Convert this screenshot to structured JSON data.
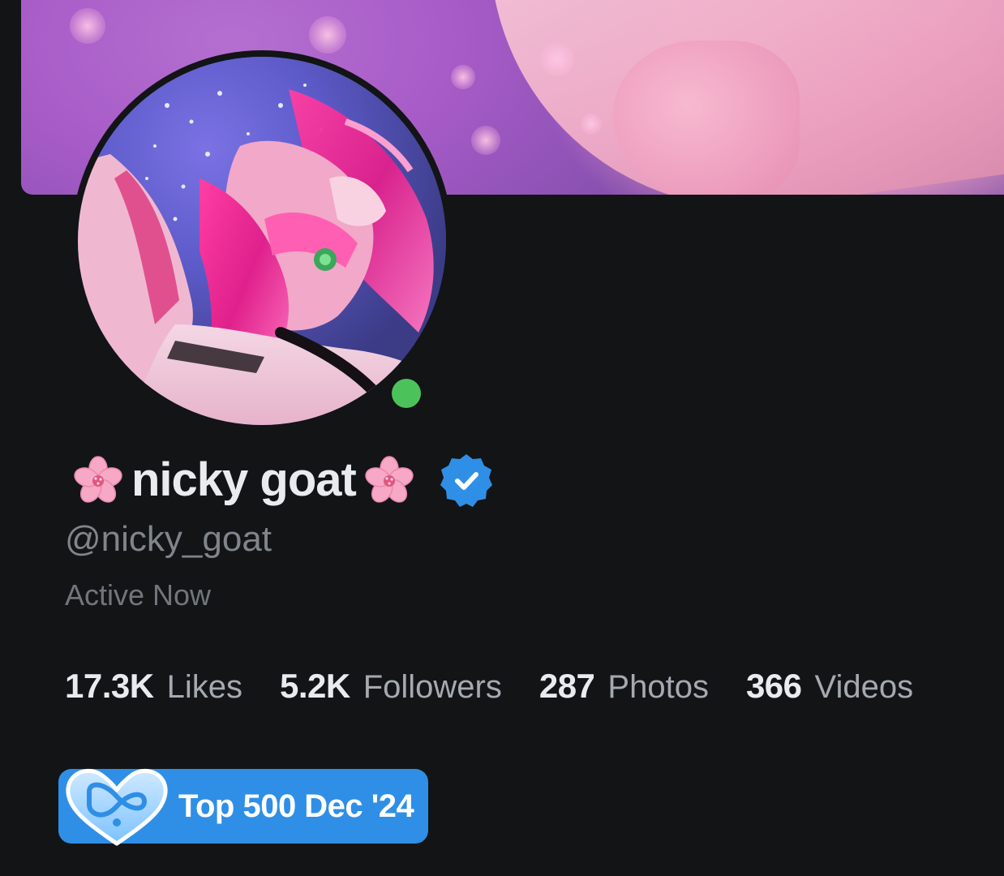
{
  "profile": {
    "display_name": "nicky goat",
    "name_decoration_icon": "cherry-blossom-icon",
    "verified_icon": "verified-check-icon",
    "handle": "@nicky_goat",
    "status": "Active Now",
    "online": true
  },
  "stats": [
    {
      "value": "17.3K",
      "label": "Likes"
    },
    {
      "value": "5.2K",
      "label": "Followers"
    },
    {
      "value": "287",
      "label": "Photos"
    },
    {
      "value": "366",
      "label": "Videos"
    }
  ],
  "badge": {
    "icon": "infinity-heart-icon",
    "label": "Top 500 Dec '24"
  },
  "colors": {
    "background": "#121416",
    "accent_blue": "#2f8fe6",
    "online_green": "#4cc35a",
    "text_primary": "#e9ecef",
    "text_secondary": "#7f858b"
  }
}
